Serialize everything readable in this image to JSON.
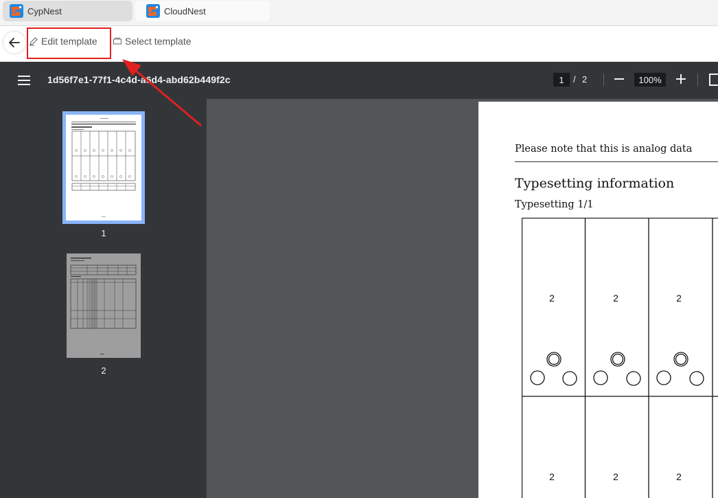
{
  "tabs": [
    {
      "label": "CypNest",
      "icon": "cypnest-logo-icon"
    },
    {
      "label": "CloudNest",
      "icon": "cloudnest-logo-icon"
    }
  ],
  "toolbar": {
    "edit_label": "Edit template",
    "select_label": "Select template"
  },
  "viewer": {
    "title": "1d56f7e1-77f1-4c4d-a6d4-abd62b449f2c",
    "current_page": "1",
    "page_separator": "/",
    "total_pages": "2",
    "zoom": "100%"
  },
  "thumbnails": [
    {
      "label": "1",
      "selected": true
    },
    {
      "label": "2",
      "selected": false
    }
  ],
  "document": {
    "note": "Please note that this is analog data",
    "heading": "Typesetting information",
    "subheading": "Typesetting 1/1",
    "cell_values": [
      "2",
      "2",
      "2",
      "2",
      "2",
      "2"
    ]
  },
  "colors": {
    "viewer_bg": "#323639",
    "canvas_bg": "#525659",
    "thumb_selected": "#8ab4f8",
    "annotation_red": "#e02020",
    "logo_orange": "#f26522",
    "logo_blue": "#1e88e5"
  }
}
